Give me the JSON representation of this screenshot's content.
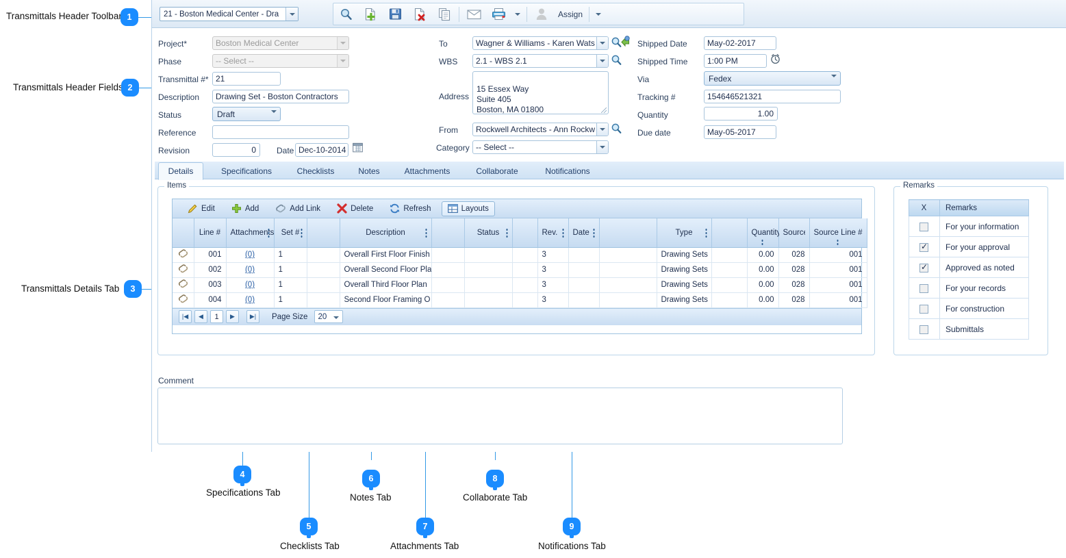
{
  "annotations": [
    {
      "n": "1",
      "label": "Transmittals Header Toolbar"
    },
    {
      "n": "2",
      "label": "Transmittals Header Fields"
    },
    {
      "n": "3",
      "label": "Transmittals Details Tab"
    },
    {
      "n": "4",
      "label": "Specifications Tab"
    },
    {
      "n": "5",
      "label": "Checklists Tab"
    },
    {
      "n": "6",
      "label": "Notes Tab"
    },
    {
      "n": "7",
      "label": "Attachments Tab"
    },
    {
      "n": "8",
      "label": "Collaborate Tab"
    },
    {
      "n": "9",
      "label": "Notifications Tab"
    }
  ],
  "toolbar": {
    "record_selector_value": "21 - Boston Medical Center - Dra",
    "assign_label": "Assign",
    "icons": [
      "search-icon",
      "new-document-icon",
      "save-icon",
      "delete-document-icon",
      "copy-icon",
      "email-icon",
      "print-icon",
      "print-dropdown-icon",
      "user-icon",
      "assign-dropdown-icon"
    ]
  },
  "header": {
    "project": {
      "label": "Project*",
      "value": "Boston Medical Center"
    },
    "phase": {
      "label": "Phase",
      "value": "-- Select --"
    },
    "transmittal_no": {
      "label": "Transmittal #*",
      "value": "21"
    },
    "description": {
      "label": "Description",
      "value": "Drawing Set - Boston Contractors"
    },
    "status": {
      "label": "Status",
      "value": "Draft"
    },
    "reference": {
      "label": "Reference",
      "value": ""
    },
    "revision": {
      "label": "Revision",
      "value": "0"
    },
    "date": {
      "label": "Date",
      "value": "Dec-10-2014"
    },
    "to": {
      "label": "To",
      "value": "Wagner & Williams - Karen Wats"
    },
    "wbs": {
      "label": "WBS",
      "value": "2.1 - WBS 2.1"
    },
    "address": {
      "label": "Address",
      "value": "15 Essex Way\nSuite 405\nBoston, MA 01800"
    },
    "from": {
      "label": "From",
      "value": "Rockwell Architects - Ann Rockw"
    },
    "category": {
      "label": "Category",
      "value": "-- Select --"
    },
    "shipped_date": {
      "label": "Shipped Date",
      "value": "May-02-2017"
    },
    "shipped_time": {
      "label": "Shipped Time",
      "value": "1:00 PM"
    },
    "via": {
      "label": "Via",
      "value": "Fedex"
    },
    "tracking": {
      "label": "Tracking #",
      "value": "154646521321"
    },
    "quantity": {
      "label": "Quantity",
      "value": "1.00"
    },
    "due_date": {
      "label": "Due date",
      "value": "May-05-2017"
    }
  },
  "tabs": [
    {
      "label": "Details",
      "active": true
    },
    {
      "label": "Specifications",
      "active": false
    },
    {
      "label": "Checklists",
      "active": false
    },
    {
      "label": "Notes",
      "active": false
    },
    {
      "label": "Attachments",
      "active": false
    },
    {
      "label": "Collaborate",
      "active": false
    },
    {
      "label": "Notifications",
      "active": false
    }
  ],
  "items_panel": {
    "caption": "Items",
    "toolbar": [
      {
        "label": "Edit",
        "icon": "pencil-icon"
      },
      {
        "label": "Add",
        "icon": "plus-icon"
      },
      {
        "label": "Add Link",
        "icon": "link-icon"
      },
      {
        "label": "Delete",
        "icon": "delete-x-icon"
      },
      {
        "label": "Refresh",
        "icon": "refresh-icon"
      },
      {
        "label": "Layouts",
        "icon": "layouts-icon"
      }
    ],
    "columns": [
      "",
      "Line #",
      "Attachments",
      "Set #",
      "",
      "Description",
      "",
      "Status",
      "",
      "Rev.",
      "Date",
      "",
      "Type",
      "",
      "Quantity",
      "Source ID",
      "Source Line #"
    ],
    "rows": [
      {
        "attach_icon": "paperclip-icon",
        "line": "001",
        "attachments": "(0)",
        "set": "1",
        "description": "Overall First Floor Finish",
        "status": "",
        "rev": "3",
        "date": "",
        "type": "Drawing Sets",
        "quantity": "0.00",
        "source_id": "028",
        "source_line": "001"
      },
      {
        "attach_icon": "paperclip-icon",
        "line": "002",
        "attachments": "(0)",
        "set": "1",
        "description": "Overall Second Floor Pla",
        "status": "",
        "rev": "3",
        "date": "",
        "type": "Drawing Sets",
        "quantity": "0.00",
        "source_id": "028",
        "source_line": "001"
      },
      {
        "attach_icon": "paperclip-icon",
        "line": "003",
        "attachments": "(0)",
        "set": "1",
        "description": "Overall Third Floor Plan",
        "status": "",
        "rev": "3",
        "date": "",
        "type": "Drawing Sets",
        "quantity": "0.00",
        "source_id": "028",
        "source_line": "001"
      },
      {
        "attach_icon": "paperclip-icon",
        "line": "004",
        "attachments": "(0)",
        "set": "1",
        "description": "Second Floor Framing O",
        "status": "",
        "rev": "3",
        "date": "",
        "type": "Drawing Sets",
        "quantity": "0.00",
        "source_id": "028",
        "source_line": "001"
      }
    ],
    "pager": {
      "first": "first-page-icon",
      "prev": "prev-page-icon",
      "current": "1",
      "next": "next-page-icon",
      "last": "last-page-icon",
      "page_size_label": "Page Size",
      "page_size_value": "20"
    }
  },
  "remarks_panel": {
    "caption": "Remarks",
    "columns": [
      "X",
      "Remarks"
    ],
    "rows": [
      {
        "checked": false,
        "label": "For your information"
      },
      {
        "checked": true,
        "label": "For your approval"
      },
      {
        "checked": true,
        "label": "Approved as noted"
      },
      {
        "checked": false,
        "label": "For your records"
      },
      {
        "checked": false,
        "label": "For construction"
      },
      {
        "checked": false,
        "label": "Submittals"
      }
    ]
  },
  "comment": {
    "label": "Comment",
    "value": ""
  },
  "colors": {
    "accent": "#1a8cff",
    "leader": "#3399e6",
    "chrome": "#cfe2f4",
    "text": "#20304f"
  }
}
